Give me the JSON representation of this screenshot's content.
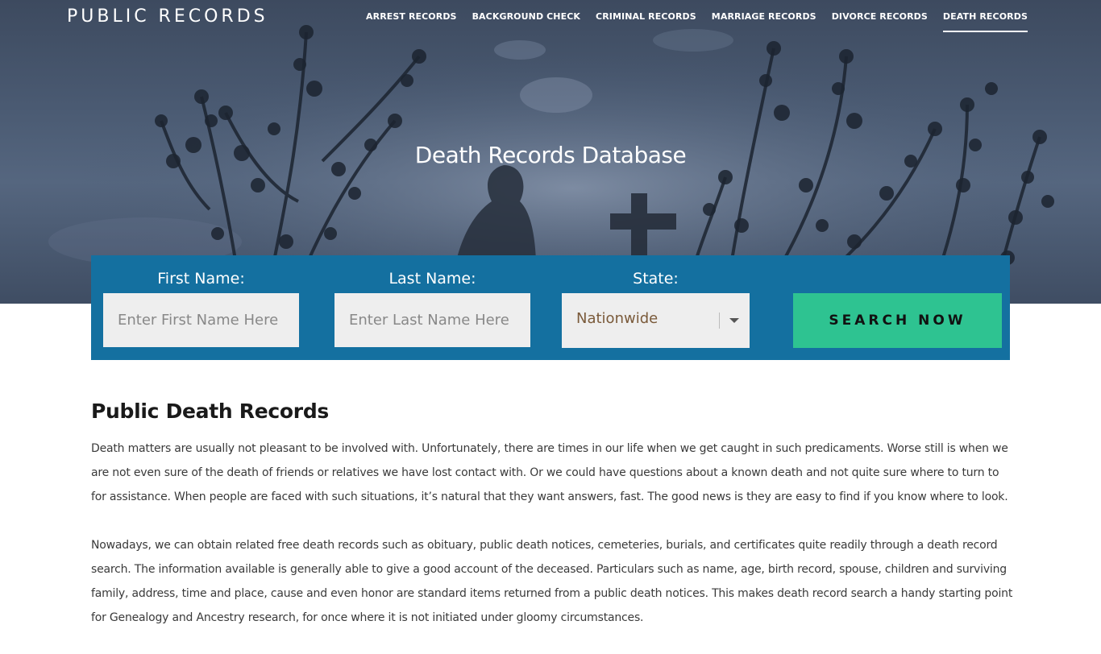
{
  "header": {
    "brand": "PUBLIC RECORDS",
    "nav": [
      {
        "label": "ARREST RECORDS",
        "active": false
      },
      {
        "label": "BACKGROUND CHECK",
        "active": false
      },
      {
        "label": "CRIMINAL RECORDS",
        "active": false
      },
      {
        "label": "MARRIAGE RECORDS",
        "active": false
      },
      {
        "label": "DIVORCE RECORDS",
        "active": false
      },
      {
        "label": "DEATH RECORDS",
        "active": true
      }
    ]
  },
  "hero": {
    "title": "Death Records Database"
  },
  "search": {
    "first_name_label": "First Name:",
    "first_name_placeholder": "Enter First Name Here",
    "last_name_label": "Last Name:",
    "last_name_placeholder": "Enter Last Name Here",
    "state_label": "State:",
    "state_value": "Nationwide",
    "button_label": "SEARCH NOW"
  },
  "content": {
    "heading": "Public Death Records",
    "paragraphs": [
      "Death matters are usually not pleasant to be involved with. Unfortunately, there are times in our life when we get caught in such predicaments. Worse still is when we are not even sure of the death of friends or relatives we have lost contact with. Or we could have questions about a known death and not quite sure where to turn to for assistance. When people are faced with such situations, it’s natural that they want answers, fast. The good news is they are easy to find if you know where to look.",
      "Nowadays, we can obtain related free death records such as obituary, public death notices, cemeteries, burials, and certificates quite readily through a death record search. The information available is generally able to give a good account of the deceased. Particulars such as name, age, birth record, spouse, children and surviving family, address, time and place, cause and even honor are standard items returned from a public death notices. This makes death record search a handy starting point for Genealogy and Ancestry research, for once where it is not initiated under gloomy circumstances."
    ]
  },
  "colors": {
    "searchbar_bg": "#1470a0",
    "button_bg": "#2ec391",
    "input_bg": "#eeeeee"
  }
}
